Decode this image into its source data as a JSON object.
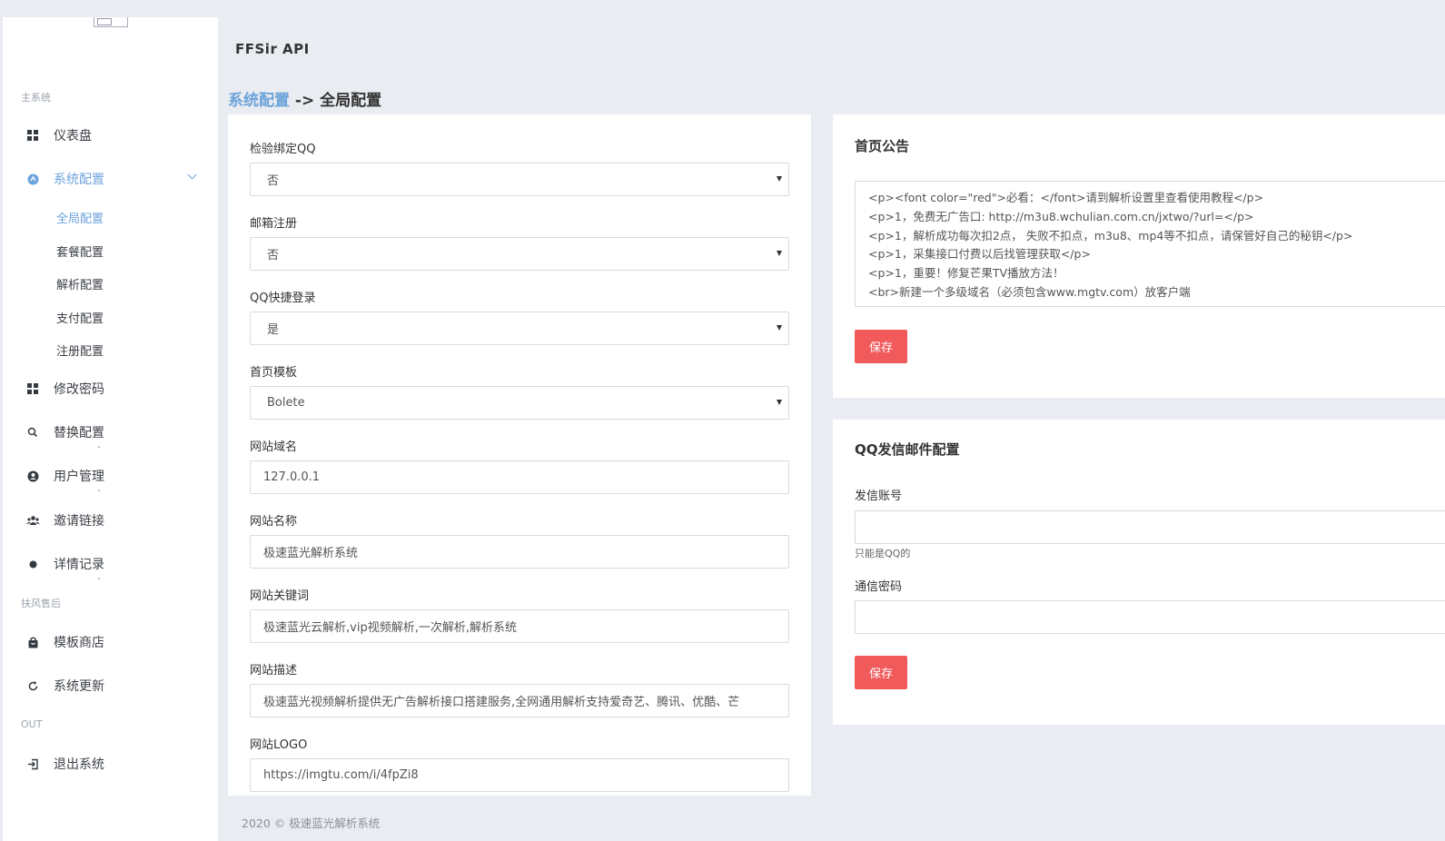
{
  "app": {
    "title": "FFSir API"
  },
  "sidebar": {
    "section_main": "主系统",
    "section_after": "扶风售后",
    "section_out": "OUT",
    "items": [
      {
        "label": "仪表盘",
        "icon": "dashboard-icon"
      },
      {
        "label": "系统配置",
        "icon": "settings-icon"
      },
      {
        "label": "修改密码",
        "icon": "dashboard-icon"
      },
      {
        "label": "替换配置",
        "icon": "search-icon"
      },
      {
        "label": "用户管理",
        "icon": "user-icon"
      },
      {
        "label": "邀请链接",
        "icon": "users-icon"
      },
      {
        "label": "详情记录",
        "icon": "dot-icon"
      },
      {
        "label": "模板商店",
        "icon": "shop-icon"
      },
      {
        "label": "系统更新",
        "icon": "refresh-icon"
      },
      {
        "label": "退出系统",
        "icon": "logout-icon"
      }
    ],
    "subitems": [
      "全局配置",
      "套餐配置",
      "解析配置",
      "支付配置",
      "注册配置"
    ]
  },
  "breadcrumb": {
    "parent": "系统配置",
    "separator": "->",
    "current": "全局配置"
  },
  "form": {
    "qq_bind_label": "检验绑定QQ",
    "qq_bind_value": "否",
    "email_reg_label": "邮箱注册",
    "email_reg_value": "否",
    "qq_login_label": "QQ快捷登录",
    "qq_login_value": "是",
    "template_label": "首页模板",
    "template_value": "Bolete",
    "domain_label": "网站域名",
    "domain_value": "127.0.0.1",
    "site_name_label": "网站名称",
    "site_name_value": "极速蓝光解析系统",
    "keywords_label": "网站关键词",
    "keywords_value": "极速蓝光云解析,vip视频解析,一次解析,解析系统",
    "desc_label": "网站描述",
    "desc_value": "极速蓝光视频解析提供无广告解析接口搭建服务,全网通用解析支持爱奇艺、腾讯、优酷、芒",
    "logo_label": "网站LOGO",
    "logo_value": "https://imgtu.com/i/4fpZi8"
  },
  "notice": {
    "title": "首页公告",
    "lines": [
      "<p><font color=\"red\">必看：</font>请到解析设置里查看使用教程</p>",
      "<p>1，免费无广告口: http://m3u8.wchulian.com.cn/jxtwo/?url=</p>",
      "<p>1，解析成功每次扣2点， 失败不扣点，m3u8、mp4等不扣点，请保管好自己的秘钥</p>",
      "<p>1，采集接口付费以后找管理获取</p>",
      "<p>1，重要！修复芒果TV播放方法！",
      "<br>新建一个多级域名（必须包含www.mgtv.com）放客户端"
    ],
    "save_label": "保存"
  },
  "mail": {
    "title": "QQ发信邮件配置",
    "account_label": "发信账号",
    "account_value": "",
    "account_help": "只能是QQ的",
    "password_label": "通信密码",
    "password_value": "",
    "save_label": "保存"
  },
  "footer": {
    "text": "2020 © 极速蓝光解析系统"
  },
  "colors": {
    "accent": "#6da3dc",
    "danger": "#f05a5b",
    "background": "#e9ecf0"
  }
}
